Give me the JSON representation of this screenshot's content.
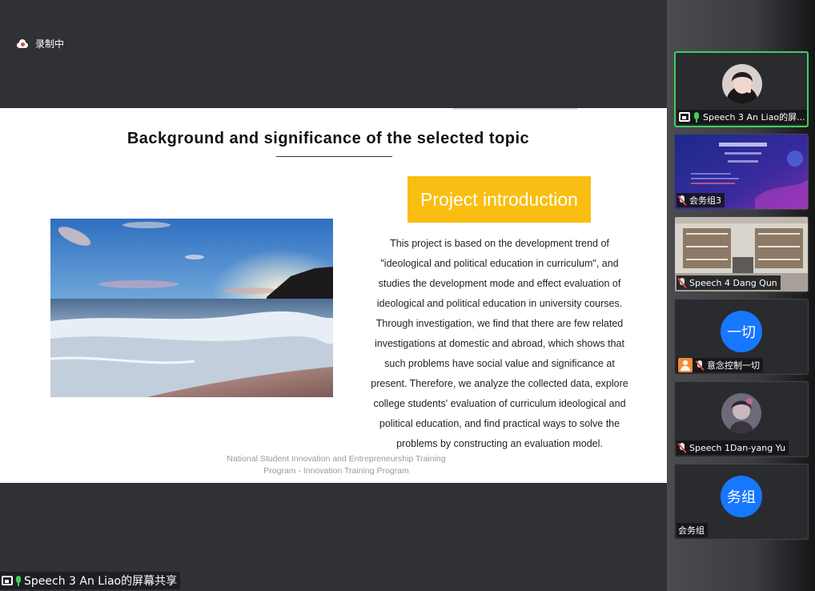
{
  "recording": {
    "label": "录制中"
  },
  "slide": {
    "title": "Background  and significance of the selected topic",
    "intro_label": "Project introduction",
    "body_lines": [
      "This project is based on the development trend of",
      "\"ideological and political education in curriculum\", and",
      "studies the development mode and effect evaluation of",
      "ideological and political education in university courses.",
      "Through investigation, we find that there are few related",
      "investigations at domestic and abroad, which shows that",
      "such problems have social value and significance at",
      "present. Therefore, we analyze the collected data, explore",
      "college students' evaluation of curriculum ideological and",
      "political education, and find practical ways to solve the",
      "problems by constructing an evaluation model."
    ],
    "footer_line1": "National Student Innovation and Entrepreneurship Training",
    "footer_line2": "Program - Innovation Training Program"
  },
  "share_label": "Speech 3 An Liao的屏幕共享",
  "participants": [
    {
      "name": "Speech 3 An Liao的屏...",
      "status": "speaking",
      "avatar": "photo"
    },
    {
      "name": "会务组3",
      "status": "muted",
      "avatar": "video"
    },
    {
      "name": "Speech 4 Dang Qun",
      "status": "muted",
      "avatar": "video"
    },
    {
      "name": "意念控制一切",
      "status": "muted",
      "avatar_text": "一切"
    },
    {
      "name": "Speech 1Dan-yang Yu",
      "status": "muted",
      "avatar": "photo"
    },
    {
      "name": "会务组",
      "status": "none",
      "avatar_text": "务组"
    }
  ],
  "colors": {
    "accent_green": "#3ecf5e",
    "intro_yellow": "#f9be11",
    "avatar_blue": "#1677ff",
    "muted_red": "#e5484d"
  }
}
